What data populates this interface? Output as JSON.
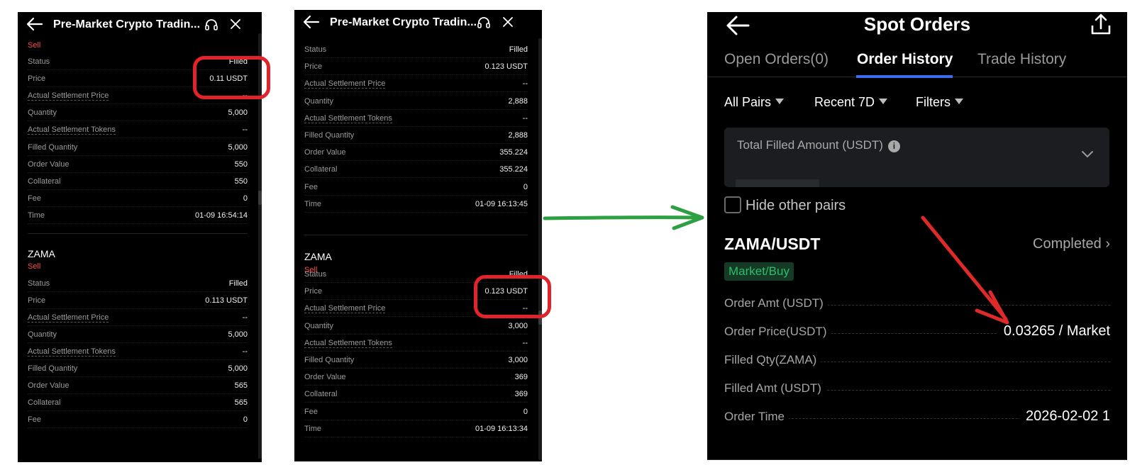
{
  "panel1": {
    "title": "Pre-Market Crypto Tradin...",
    "order1": {
      "side": "Sell",
      "rows": [
        {
          "k": "Status",
          "v": "Filled"
        },
        {
          "k": "Price",
          "v": "0.11 USDT"
        },
        {
          "k": "Actual Settlement Price",
          "v": "--"
        },
        {
          "k": "Quantity",
          "v": "5,000"
        },
        {
          "k": "Actual Settlement Tokens",
          "v": "--"
        },
        {
          "k": "Filled Quantity",
          "v": "5,000"
        },
        {
          "k": "Order Value",
          "v": "550"
        },
        {
          "k": "Collateral",
          "v": "550"
        },
        {
          "k": "Fee",
          "v": "0"
        },
        {
          "k": "Time",
          "v": "01-09 16:54:14"
        }
      ]
    },
    "order2": {
      "symbol": "ZAMA",
      "side": "Sell",
      "rows": [
        {
          "k": "Status",
          "v": "Filled"
        },
        {
          "k": "Price",
          "v": "0.113 USDT"
        },
        {
          "k": "Actual Settlement Price",
          "v": "--"
        },
        {
          "k": "Quantity",
          "v": "5,000"
        },
        {
          "k": "Actual Settlement Tokens",
          "v": "--"
        },
        {
          "k": "Filled Quantity",
          "v": "5,000"
        },
        {
          "k": "Order Value",
          "v": "565"
        },
        {
          "k": "Collateral",
          "v": "565"
        },
        {
          "k": "Fee",
          "v": "0"
        }
      ]
    }
  },
  "panel2": {
    "title": "Pre-Market Crypto Tradin...",
    "order1": {
      "rows": [
        {
          "k": "Status",
          "v": "Filled"
        },
        {
          "k": "Price",
          "v": "0.123 USDT"
        },
        {
          "k": "Actual Settlement Price",
          "v": "--"
        },
        {
          "k": "Quantity",
          "v": "2,888"
        },
        {
          "k": "Actual Settlement Tokens",
          "v": "--"
        },
        {
          "k": "Filled Quantity",
          "v": "2,888"
        },
        {
          "k": "Order Value",
          "v": "355.224"
        },
        {
          "k": "Collateral",
          "v": "355.224"
        },
        {
          "k": "Fee",
          "v": "0"
        },
        {
          "k": "Time",
          "v": "01-09 16:13:45"
        }
      ]
    },
    "order2": {
      "symbol": "ZAMA",
      "side": "Sell",
      "rows": [
        {
          "k": "Status",
          "v": "Filled"
        },
        {
          "k": "Price",
          "v": "0.123 USDT"
        },
        {
          "k": "Actual Settlement Price",
          "v": "--"
        },
        {
          "k": "Quantity",
          "v": "3,000"
        },
        {
          "k": "Actual Settlement Tokens",
          "v": "--"
        },
        {
          "k": "Filled Quantity",
          "v": "3,000"
        },
        {
          "k": "Order Value",
          "v": "369"
        },
        {
          "k": "Collateral",
          "v": "369"
        },
        {
          "k": "Fee",
          "v": "0"
        },
        {
          "k": "Time",
          "v": "01-09 16:13:34"
        }
      ]
    }
  },
  "panel3": {
    "title": "Spot Orders",
    "tabs": [
      "Open Orders(0)",
      "Order History",
      "Trade History"
    ],
    "filters": [
      "All Pairs",
      "Recent 7D",
      "Filters"
    ],
    "total_label": "Total Filled Amount (USDT)",
    "info_glyph": "i",
    "hide_label": "Hide other pairs",
    "pair": "ZAMA/USDT",
    "status": "Completed",
    "badge": "Market/Buy",
    "rows": [
      {
        "k": "Order Amt (USDT)",
        "v": ""
      },
      {
        "k": "Order Price(USDT)",
        "v": "0.03265 / Market"
      },
      {
        "k": "Filled Qty(ZAMA)",
        "v": ""
      },
      {
        "k": "Filled Amt (USDT)",
        "v": ""
      },
      {
        "k": "Order Time",
        "v": "2026-02-02 1"
      }
    ]
  },
  "colors": {
    "sell": "#ff4d4f",
    "highlight_circle": "#e2242a",
    "green_arrow": "#2ea043",
    "red_arrow": "#e02a2a",
    "tab_underline": "#3d6cf0",
    "badge_green": "#2ebd6b"
  }
}
